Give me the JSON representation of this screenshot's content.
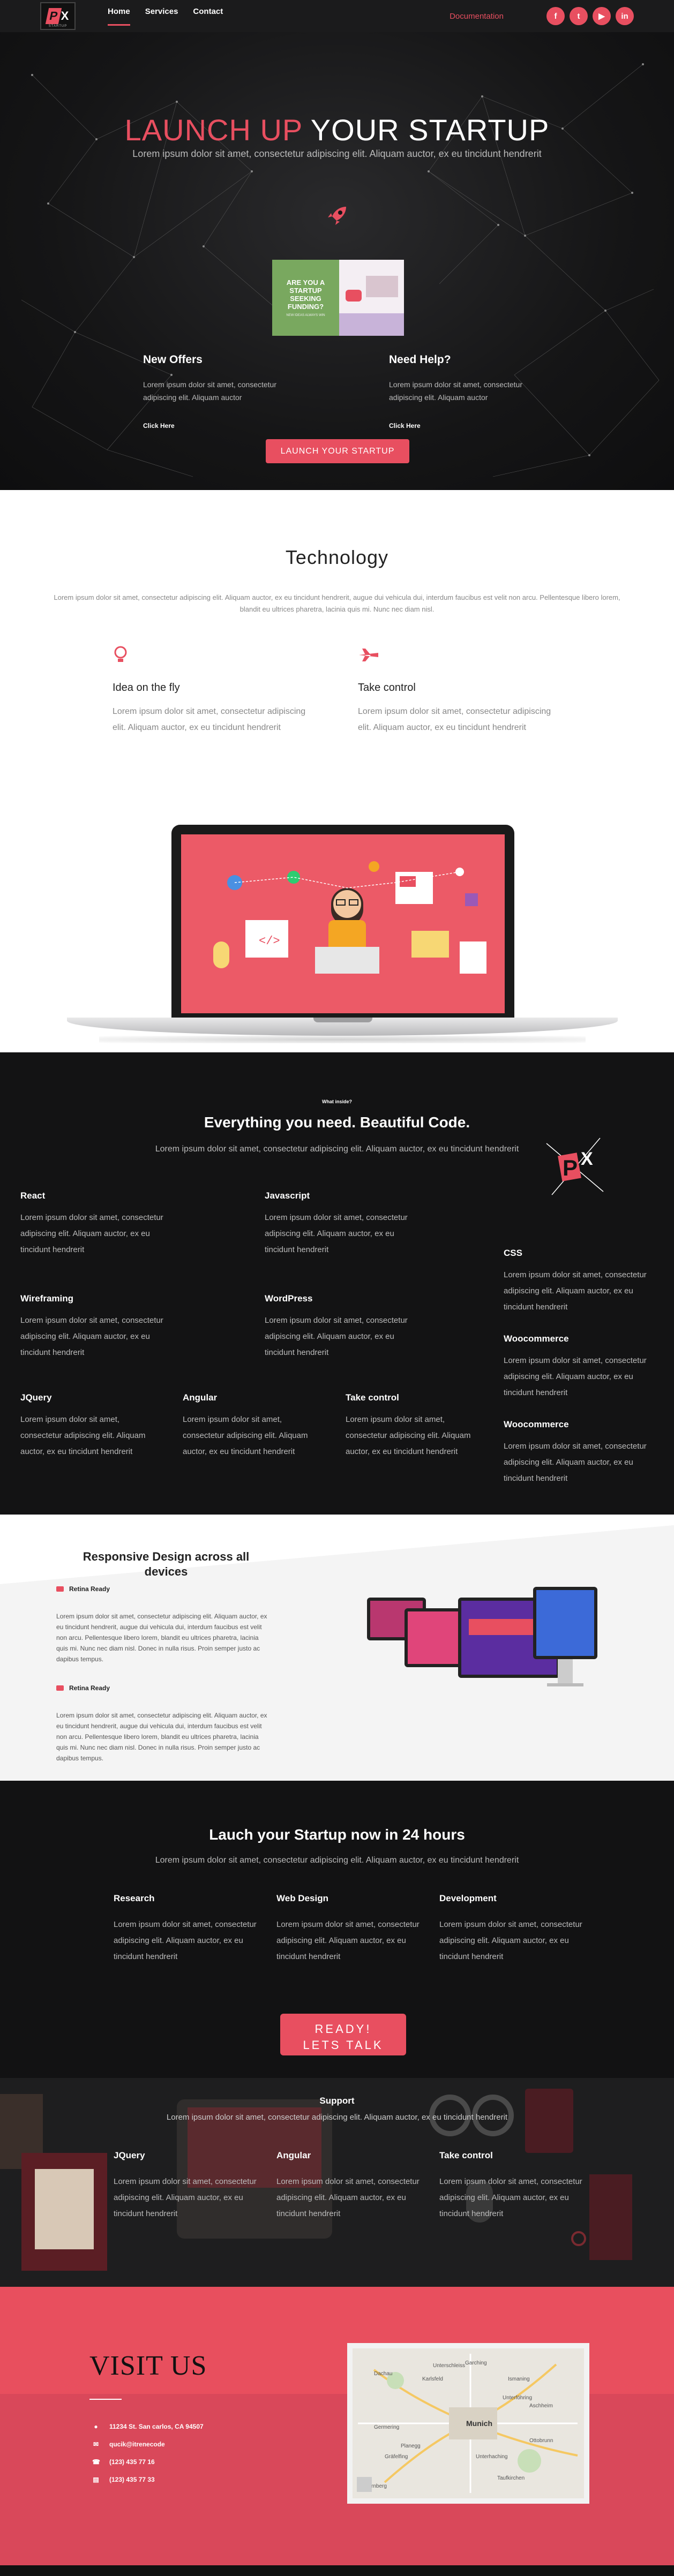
{
  "nav": {
    "logo": {
      "mark": "P",
      "x": "X",
      "sub": "STARTUP"
    },
    "links": [
      "Home",
      "Services",
      "Contact"
    ],
    "documentation": "Documentation",
    "socials": [
      "facebook-icon",
      "twitter-icon",
      "youtube-icon",
      "linkedin-icon"
    ],
    "social_glyphs": [
      "f",
      "t",
      "▶",
      "in"
    ]
  },
  "hero": {
    "title_red": "LAUNCH UP",
    "title_white": "YOUR STARTUP",
    "subtitle": "Lorem ipsum dolor sit amet, consectetur adipiscing elit. Aliquam auctor, ex eu tincidunt hendrerit",
    "video": {
      "headline": "ARE YOU A STARTUP SEEKING FUNDING?",
      "caption": "NEW IDEAS ALWAYS WIN"
    },
    "columns": [
      {
        "title": "New Offers",
        "text": "Lorem ipsum dolor sit amet, consectetur adipiscing elit. Aliquam auctor",
        "link": "Click Here"
      },
      {
        "title": "Need Help?",
        "text": "Lorem ipsum dolor sit amet, consectetur adipiscing elit. Aliquam auctor",
        "link": "Click Here"
      }
    ],
    "button": "LAUNCH YOUR STARTUP"
  },
  "technology": {
    "title": "Technology",
    "intro": "Lorem ipsum dolor sit amet, consectetur adipiscing elit. Aliquam auctor, ex eu tincidunt hendrerit, augue dui vehicula dui, interdum faucibus est velit non arcu. Pellentesque libero lorem, blandit eu ultrices pharetra, lacinia quis mi. Nunc nec diam nisl.",
    "features": [
      {
        "icon": "lightbulb-icon",
        "title": "Idea on the fly",
        "text": "Lorem ipsum dolor sit amet, consectetur adipiscing elit. Aliquam auctor, ex eu tincidunt hendrerit"
      },
      {
        "icon": "airplane-icon",
        "title": "Take control",
        "text": "Lorem ipsum dolor sit amet, consectetur adipiscing elit. Aliquam auctor, ex eu tincidunt hendrerit"
      }
    ]
  },
  "inside": {
    "kicker": "What inside?",
    "title": "Everything you need. Beautiful Code.",
    "intro": "Lorem ipsum dolor sit amet, consectetur adipiscing elit. Aliquam auctor, ex eu tincidunt hendrerit",
    "items": [
      {
        "title": "React",
        "text": "Lorem ipsum dolor sit amet, consectetur adipiscing elit. Aliquam auctor, ex eu tincidunt hendrerit"
      },
      {
        "title": "Javascript",
        "text": "Lorem ipsum dolor sit amet, consectetur adipiscing elit. Aliquam auctor, ex eu tincidunt hendrerit"
      },
      {
        "title": "CSS",
        "text": "Lorem ipsum dolor sit amet, consectetur adipiscing elit. Aliquam auctor, ex eu tincidunt hendrerit"
      },
      {
        "title": "Wireframing",
        "text": "Lorem ipsum dolor sit amet, consectetur adipiscing elit. Aliquam auctor, ex eu tincidunt hendrerit"
      },
      {
        "title": "WordPress",
        "text": "Lorem ipsum dolor sit amet, consectetur adipiscing elit. Aliquam auctor, ex eu tincidunt hendrerit"
      },
      {
        "title": "Woocommerce",
        "text": "Lorem ipsum dolor sit amet, consectetur adipiscing elit. Aliquam auctor, ex eu tincidunt hendrerit"
      },
      {
        "title": "JQuery",
        "text": "Lorem ipsum dolor sit amet, consectetur adipiscing elit. Aliquam auctor, ex eu tincidunt hendrerit"
      },
      {
        "title": "Angular",
        "text": "Lorem ipsum dolor sit amet, consectetur adipiscing elit. Aliquam auctor, ex eu tincidunt hendrerit"
      },
      {
        "title": "Take control",
        "text": "Lorem ipsum dolor sit amet, consectetur adipiscing elit. Aliquam auctor, ex eu tincidunt hendrerit"
      },
      {
        "title": "Woocommerce",
        "text": "Lorem ipsum dolor sit amet, consectetur adipiscing elit. Aliquam auctor, ex eu tincidunt hendrerit"
      }
    ]
  },
  "responsive": {
    "title": "Responsive Design across all devices",
    "items": [
      {
        "label": "Retina Ready",
        "text": "Lorem ipsum dolor sit amet, consectetur adipiscing elit. Aliquam auctor, ex eu tincidunt hendrerit, augue dui vehicula dui, interdum faucibus est velit non arcu. Pellentesque libero lorem, blandit eu ultrices pharetra, lacinia quis mi. Nunc nec diam nisl. Donec in nulla risus. Proin semper justo ac dapibus tempus."
      },
      {
        "label": "Retina Ready",
        "text": "Lorem ipsum dolor sit amet, consectetur adipiscing elit. Aliquam auctor, ex eu tincidunt hendrerit, augue dui vehicula dui, interdum faucibus est velit non arcu. Pellentesque libero lorem, blandit eu ultrices pharetra, lacinia quis mi. Nunc nec diam nisl. Donec in nulla risus. Proin semper justo ac dapibus tempus."
      }
    ]
  },
  "launch": {
    "title": "Lauch your Startup now in 24 hours",
    "intro": "Lorem ipsum dolor sit amet, consectetur adipiscing elit. Aliquam auctor, ex eu tincidunt hendrerit",
    "columns": [
      {
        "title": "Research",
        "text": "Lorem ipsum dolor sit amet, consectetur adipiscing elit. Aliquam auctor, ex eu tincidunt hendrerit"
      },
      {
        "title": "Web Design",
        "text": "Lorem ipsum dolor sit amet, consectetur adipiscing elit. Aliquam auctor, ex eu tincidunt hendrerit"
      },
      {
        "title": "Development",
        "text": "Lorem ipsum dolor sit amet, consectetur adipiscing elit. Aliquam auctor, ex eu tincidunt hendrerit"
      }
    ],
    "button": "READY!\nLETS TALK",
    "support": {
      "title": "Support",
      "text": "Lorem ipsum dolor sit amet, consectetur adipiscing elit. Aliquam auctor, ex eu tincidunt hendrerit"
    },
    "bottom": [
      {
        "title": "JQuery",
        "text": "Lorem ipsum dolor sit amet, consectetur adipiscing elit. Aliquam auctor, ex eu tincidunt hendrerit"
      },
      {
        "title": "Angular",
        "text": "Lorem ipsum dolor sit amet, consectetur adipiscing elit. Aliquam auctor, ex eu tincidunt hendrerit"
      },
      {
        "title": "Take control",
        "text": "Lorem ipsum dolor sit amet, consectetur adipiscing elit. Aliquam auctor, ex eu tincidunt hendrerit"
      }
    ]
  },
  "visit": {
    "title": "VISIT US",
    "items": [
      {
        "icon": "map-pin-icon",
        "glyph": "●",
        "text": "11234 St. San carlos, CA 94507"
      },
      {
        "icon": "envelope-icon",
        "glyph": "✉",
        "text": "qucik@itrenecode"
      },
      {
        "icon": "phone-icon",
        "glyph": "☎",
        "text": "(123) 435 77 16"
      },
      {
        "icon": "fax-icon",
        "glyph": "▤",
        "text": "(123) 435 77 33"
      }
    ],
    "map": {
      "city": "Munich",
      "places": [
        "Garching",
        "Dachau",
        "Karlsfeld",
        "Ismaning",
        "Unterschleiss",
        "Germering",
        "Planegg",
        "Gräfelfing",
        "Unterhaching",
        "Ottobrunn",
        "Taufkirchen",
        "Starnberg",
        "Aschheim",
        "Unterföhring"
      ]
    }
  },
  "colors": {
    "accent": "#e84f60",
    "dark": "#131314"
  }
}
